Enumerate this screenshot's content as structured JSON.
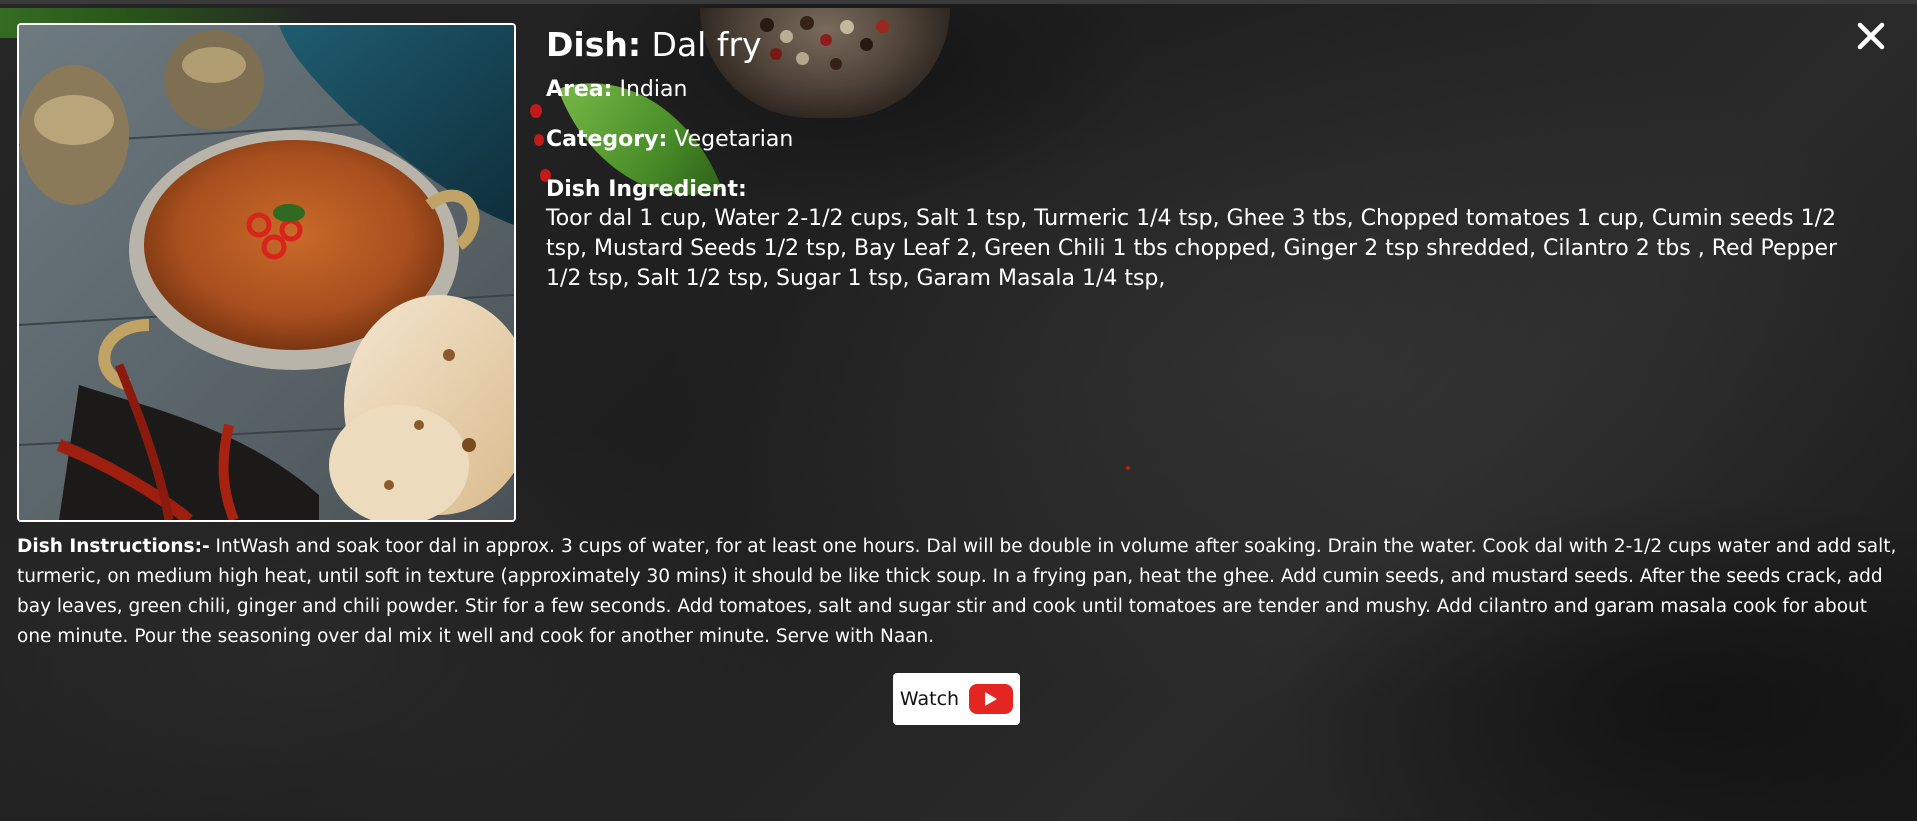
{
  "dish": {
    "title_label": "Dish:",
    "name": "Dal fry",
    "area_label": "Area:",
    "area": "Indian",
    "category_label": "Category:",
    "category": "Vegetarian",
    "ingredients_label": "Dish Ingredient:",
    "ingredients": "Toor dal 1 cup, Water 2-1/2 cups, Salt 1 tsp, Turmeric 1/4 tsp, Ghee 3 tbs, Chopped tomatoes 1 cup, Cumin seeds 1/2 tsp, Mustard Seeds 1/2 tsp, Bay Leaf 2, Green Chili 1 tbs chopped, Ginger 2 tsp shredded, Cilantro 2 tbs , Red Pepper 1/2 tsp, Salt 1/2 tsp, Sugar 1 tsp, Garam Masala 1/4 tsp,",
    "instructions_label": "Dish Instructions:-",
    "instructions": " IntWash and soak toor dal in approx. 3 cups of water, for at least one hours. Dal will be double in volume after soaking. Drain the water. Cook dal with 2-1/2 cups water and add salt, turmeric, on medium high heat, until soft in texture (approximately 30 mins) it should be like thick soup. In a frying pan, heat the ghee. Add cumin seeds, and mustard seeds. After the seeds crack, add bay leaves, green chili, ginger and chili powder. Stir for a few seconds. Add tomatoes, salt and sugar stir and cook until tomatoes are tender and mushy. Add cilantro and garam masala cook for about one minute. Pour the seasoning over dal mix it well and cook for another minute. Serve with Naan."
  },
  "watch_button": {
    "label": "Watch",
    "icon": "youtube-icon"
  },
  "close_button": {
    "icon": "close-icon"
  },
  "colors": {
    "text": "#ffffff",
    "youtube_red": "#e52521",
    "button_bg": "#ffffff"
  }
}
